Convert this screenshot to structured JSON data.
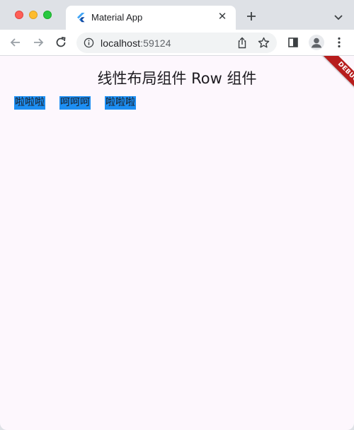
{
  "browser": {
    "tab": {
      "title": "Material App"
    },
    "address": {
      "host": "localhost",
      "port": ":59124"
    }
  },
  "app": {
    "title": "线性布局组件 Row 组件",
    "row_items": [
      "啦啦啦",
      "呵呵呵",
      "啦啦啦"
    ],
    "debug_label": "DEBUG"
  },
  "colors": {
    "cell_background": "#1d8ef2",
    "page_background": "#fdf7fd",
    "debug_ribbon": "#b71c1c"
  }
}
